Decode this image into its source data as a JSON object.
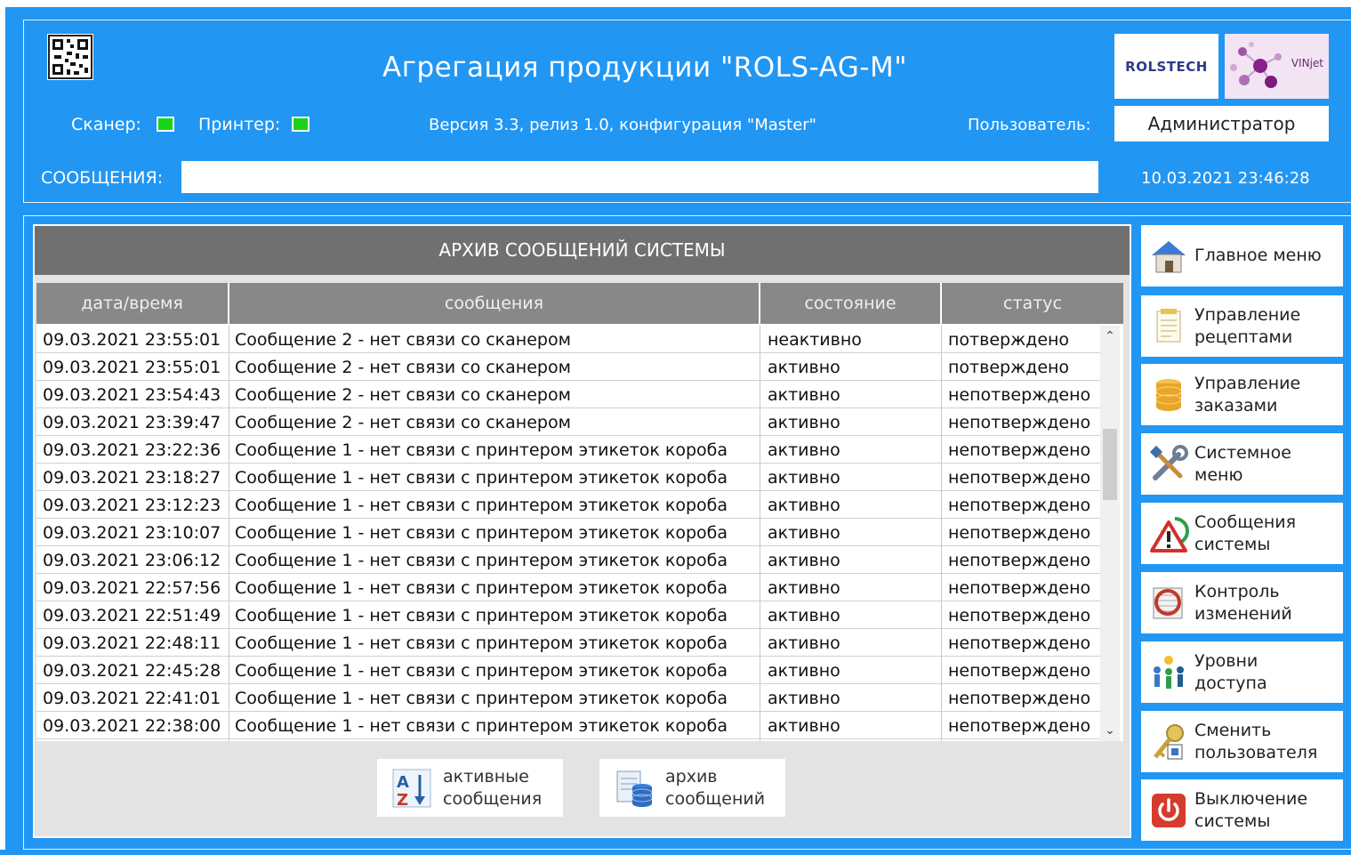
{
  "header": {
    "title": "Агрегация продукции \"ROLS-AG-M\"",
    "scanner_label": "Сканер:",
    "printer_label": "Принтер:",
    "version": "Версия 3.3, релиз 1.0, конфигурация \"Master\"",
    "user_label": "Пользователь:",
    "user_value": "Администратор",
    "messages_label": "СООБЩЕНИЯ:",
    "messages_value": "",
    "datetime": "10.03.2021 23:46:28",
    "logo_rolstech": "ROLSTECH",
    "logo_vinjet": "VINjet",
    "status_color_ok": "#16d416"
  },
  "archive": {
    "title": "АРХИВ СООБЩЕНИЙ СИСТЕМЫ",
    "columns": [
      "дата/время",
      "сообщения",
      "состояние",
      "статус"
    ],
    "rows": [
      [
        "09.03.2021 23:55:01",
        "Сообщение 2 - нет связи со сканером",
        "неактивно",
        "потверждено"
      ],
      [
        "09.03.2021 23:55:01",
        "Сообщение 2 - нет связи со сканером",
        "активно",
        "потверждено"
      ],
      [
        "09.03.2021 23:54:43",
        "Сообщение 2 - нет связи со сканером",
        "активно",
        "непотверждено"
      ],
      [
        "09.03.2021 23:39:47",
        "Сообщение 2 - нет связи со сканером",
        "активно",
        "непотверждено"
      ],
      [
        "09.03.2021 23:22:36",
        "Сообщение 1 - нет связи с принтером этикеток короба",
        "активно",
        "непотверждено"
      ],
      [
        "09.03.2021 23:18:27",
        "Сообщение 1 - нет связи с принтером этикеток короба",
        "активно",
        "непотверждено"
      ],
      [
        "09.03.2021 23:12:23",
        "Сообщение 1 - нет связи с принтером этикеток короба",
        "активно",
        "непотверждено"
      ],
      [
        "09.03.2021 23:10:07",
        "Сообщение 1 - нет связи с принтером этикеток короба",
        "активно",
        "непотверждено"
      ],
      [
        "09.03.2021 23:06:12",
        "Сообщение 1 - нет связи с принтером этикеток короба",
        "активно",
        "непотверждено"
      ],
      [
        "09.03.2021 22:57:56",
        "Сообщение 1 - нет связи с принтером этикеток короба",
        "активно",
        "непотверждено"
      ],
      [
        "09.03.2021 22:51:49",
        "Сообщение 1 - нет связи с принтером этикеток короба",
        "активно",
        "непотверждено"
      ],
      [
        "09.03.2021 22:48:11",
        "Сообщение 1 - нет связи с принтером этикеток короба",
        "активно",
        "непотверждено"
      ],
      [
        "09.03.2021 22:45:28",
        "Сообщение 1 - нет связи с принтером этикеток короба",
        "активно",
        "непотверждено"
      ],
      [
        "09.03.2021 22:41:01",
        "Сообщение 1 - нет связи с принтером этикеток короба",
        "активно",
        "непотверждено"
      ],
      [
        "09.03.2021 22:38:00",
        "Сообщение 1 - нет связи с принтером этикеток короба",
        "активно",
        "непотверждено"
      ]
    ],
    "buttons": [
      {
        "line1": "активные",
        "line2": "сообщения",
        "icon": "sort-az-icon"
      },
      {
        "line1": "архив",
        "line2": "сообщений",
        "icon": "database-archive-icon"
      }
    ]
  },
  "nav": [
    {
      "line1": "Главное меню",
      "line2": "",
      "icon": "home-icon"
    },
    {
      "line1": "Управление",
      "line2": "рецептами",
      "icon": "recipe-document-icon"
    },
    {
      "line1": "Управление",
      "line2": "заказами",
      "icon": "database-icon"
    },
    {
      "line1": "Системное",
      "line2": "меню",
      "icon": "tools-icon"
    },
    {
      "line1": "Сообщения",
      "line2": "системы",
      "icon": "warning-icon"
    },
    {
      "line1": "Контроль",
      "line2": "изменений",
      "icon": "audit-icon"
    },
    {
      "line1": "Уровни",
      "line2": "доступа",
      "icon": "users-access-icon"
    },
    {
      "line1": "Сменить",
      "line2": "пользователя",
      "icon": "key-user-icon"
    },
    {
      "line1": "Выключение",
      "line2": "системы",
      "icon": "power-icon"
    }
  ]
}
